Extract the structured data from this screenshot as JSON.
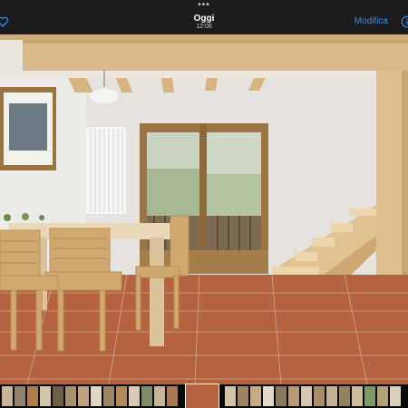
{
  "header": {
    "title": "Oggi",
    "time": "12:06",
    "edit_label": "Modifica",
    "more_dots": "•••"
  },
  "icons": {
    "favorite": "heart-outline-icon",
    "info": "info-circle-icon"
  },
  "colors": {
    "accent": "#2f8df7",
    "bar": "#1c1c1e"
  },
  "photo": {
    "description_alt": "room-photo"
  },
  "filmstrip": {
    "thumb_count": 34,
    "selected_index": 18
  }
}
